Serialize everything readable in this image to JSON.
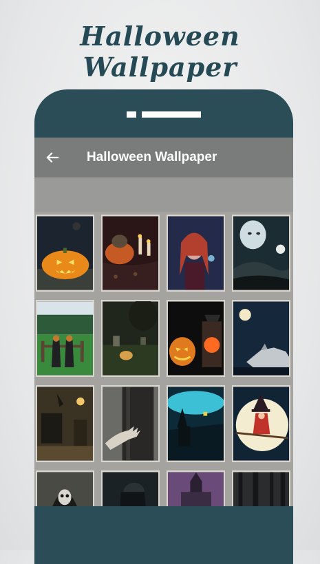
{
  "promo": {
    "title": "Halloween Wallpaper"
  },
  "appbar": {
    "title": "Halloween Wallpaper",
    "back_icon": "arrow-left-icon"
  },
  "colors": {
    "phone": "#2a4d58",
    "appbar": "#7a7b7b",
    "title_script": "#254a55"
  },
  "wallpapers": [
    {
      "name": "jack-o-lantern-night"
    },
    {
      "name": "pumpkin-candles"
    },
    {
      "name": "witch-portrait"
    },
    {
      "name": "ghost-face-moon"
    },
    {
      "name": "scarecrows-field"
    },
    {
      "name": "graveyard-pumpkin"
    },
    {
      "name": "carved-pumpkin-lantern"
    },
    {
      "name": "wolf-full-moon"
    },
    {
      "name": "haunted-room"
    },
    {
      "name": "hand-tree"
    },
    {
      "name": "witch-aurora"
    },
    {
      "name": "witch-broom-moon"
    },
    {
      "name": "skull-reaper"
    },
    {
      "name": "dark-figure"
    },
    {
      "name": "gothic-church"
    },
    {
      "name": "dark-forest"
    }
  ]
}
